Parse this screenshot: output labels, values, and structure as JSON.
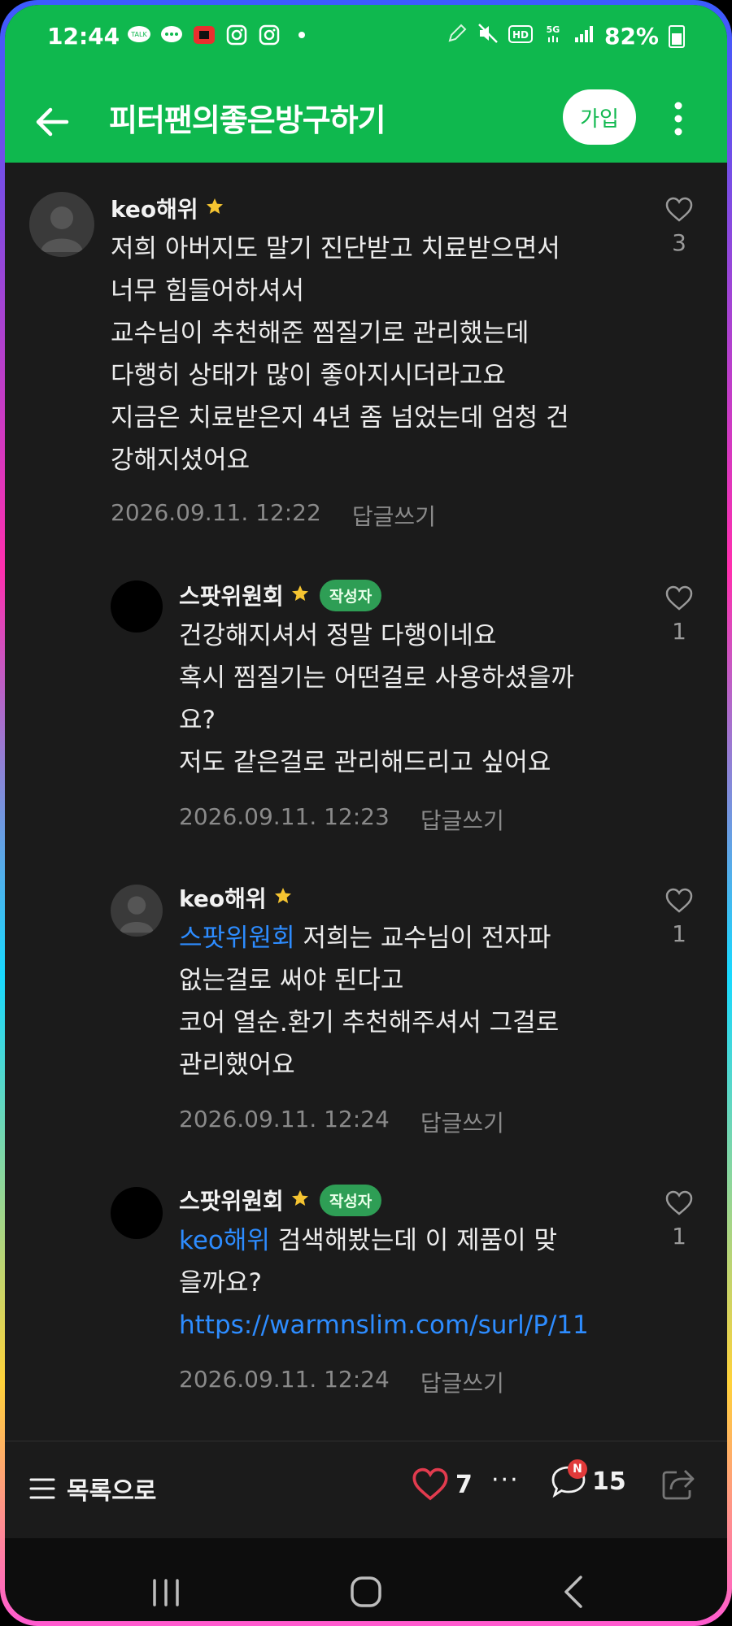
{
  "status_bar": {
    "time": "12:44",
    "battery": "82%",
    "left_icons": [
      "talk-icon",
      "chat-bubble-icon",
      "red-app-icon",
      "instagram-icon",
      "instagram-icon",
      "dot-icon"
    ],
    "right_icons": [
      "pen-icon",
      "mute-icon",
      "hd-icon",
      "5g-icon",
      "signal-icon",
      "battery-icon"
    ]
  },
  "header": {
    "title": "피터팬의좋은방구하기",
    "join_label": "가입",
    "back_icon": "arrow-left-icon",
    "more_icon": "more-vertical-icon"
  },
  "comments": [
    {
      "author": "keo해위",
      "badge": "",
      "lines": [
        "저희 아버지도 말기 진단받고 치료받으면서",
        "너무 힘들어하셔서",
        "교수님이 추천해준 찜질기로 관리했는데",
        "다행히 상태가 많이 좋아지시더라고요",
        "지금은 치료받은지 4년 좀 넘었는데 엄청 건",
        "강해지셨어요"
      ],
      "timestamp": "2026.09.11. 12:22",
      "reply_label": "답글쓰기",
      "likes": "3"
    },
    {
      "author": "스팟위원회",
      "badge": "작성자",
      "lines": [
        "건강해지셔서 정말 다행이네요",
        "혹시 찜질기는 어떤걸로 사용하셨을까",
        "요?",
        "저도 같은걸로 관리해드리고 싶어요"
      ],
      "timestamp": "2026.09.11. 12:23",
      "reply_label": "답글쓰기",
      "likes": "1"
    },
    {
      "author": "keo해위",
      "badge": "",
      "mention": "스팟위원회",
      "lines": [
        " 저희는 교수님이 전자파",
        "없는걸로 써야 된다고",
        "코어 열순.환기 추천해주셔서 그걸로",
        "관리했어요"
      ],
      "timestamp": "2026.09.11. 12:24",
      "reply_label": "답글쓰기",
      "likes": "1"
    },
    {
      "author": "스팟위원회",
      "badge": "작성자",
      "mention": "keo해위",
      "lines": [
        " 검색해봤는데 이 제품이 맞",
        "을까요?"
      ],
      "link": "https://warmnslim.com/surl/P/11",
      "timestamp": "2026.09.11. 12:24",
      "reply_label": "답글쓰기",
      "likes": "1"
    }
  ],
  "bottom_bar": {
    "list_label": "목록으로",
    "like_count": "7",
    "dots": "···",
    "new_badge": "N",
    "comment_count": "15"
  },
  "colors": {
    "brand_green": "#0fb84e",
    "background": "#1b1b1b",
    "mention_blue": "#2d8cff",
    "author_badge": "#2e9e55",
    "heart_red": "#e23b4e"
  }
}
